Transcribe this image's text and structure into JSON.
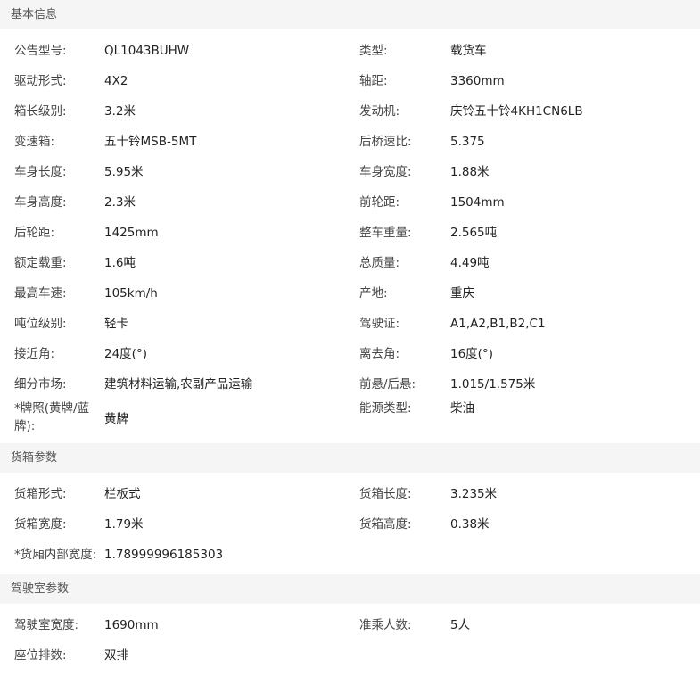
{
  "sections": [
    {
      "title": "基本信息",
      "rows": [
        [
          {
            "label": "公告型号:",
            "value": "QL1043BUHW"
          },
          {
            "label": "类型:",
            "value": "载货车"
          }
        ],
        [
          {
            "label": "驱动形式:",
            "value": "4X2"
          },
          {
            "label": "轴距:",
            "value": "3360mm"
          }
        ],
        [
          {
            "label": "箱长级别:",
            "value": "3.2米"
          },
          {
            "label": "发动机:",
            "value": "庆铃五十铃4KH1CN6LB"
          }
        ],
        [
          {
            "label": "变速箱:",
            "value": "五十铃MSB-5MT"
          },
          {
            "label": "后桥速比:",
            "value": "5.375"
          }
        ],
        [
          {
            "label": "车身长度:",
            "value": "5.95米"
          },
          {
            "label": "车身宽度:",
            "value": "1.88米"
          }
        ],
        [
          {
            "label": "车身高度:",
            "value": "2.3米"
          },
          {
            "label": "前轮距:",
            "value": "1504mm"
          }
        ],
        [
          {
            "label": "后轮距:",
            "value": "1425mm"
          },
          {
            "label": "整车重量:",
            "value": "2.565吨"
          }
        ],
        [
          {
            "label": "额定载重:",
            "value": "1.6吨"
          },
          {
            "label": "总质量:",
            "value": "4.49吨"
          }
        ],
        [
          {
            "label": "最高车速:",
            "value": "105km/h"
          },
          {
            "label": "产地:",
            "value": "重庆"
          }
        ],
        [
          {
            "label": "吨位级别:",
            "value": "轻卡"
          },
          {
            "label": "驾驶证:",
            "value": "A1,A2,B1,B2,C1"
          }
        ],
        [
          {
            "label": "接近角:",
            "value": "24度(°)"
          },
          {
            "label": "离去角:",
            "value": "16度(°)"
          }
        ],
        [
          {
            "label": "细分市场:",
            "value": "建筑材料运输,农副产品运输"
          },
          {
            "label": "前悬/后悬:",
            "value": "1.015/1.575米"
          }
        ],
        [
          {
            "label": "*牌照(黄牌/蓝牌):",
            "value": "黄牌"
          },
          {
            "label": "能源类型:",
            "value": "柴油"
          }
        ]
      ]
    },
    {
      "title": "货箱参数",
      "rows": [
        [
          {
            "label": "货箱形式:",
            "value": "栏板式"
          },
          {
            "label": "货箱长度:",
            "value": "3.235米"
          }
        ],
        [
          {
            "label": "货箱宽度:",
            "value": "1.79米"
          },
          {
            "label": "货箱高度:",
            "value": "0.38米"
          }
        ],
        [
          {
            "label": "*货厢内部宽度:",
            "value": "1.78999996185303"
          }
        ]
      ]
    },
    {
      "title": "驾驶室参数",
      "rows": [
        [
          {
            "label": "驾驶室宽度:",
            "value": "1690mm"
          },
          {
            "label": "准乘人数:",
            "value": "5人"
          }
        ],
        [
          {
            "label": "座位排数:",
            "value": "双排"
          }
        ]
      ]
    }
  ]
}
